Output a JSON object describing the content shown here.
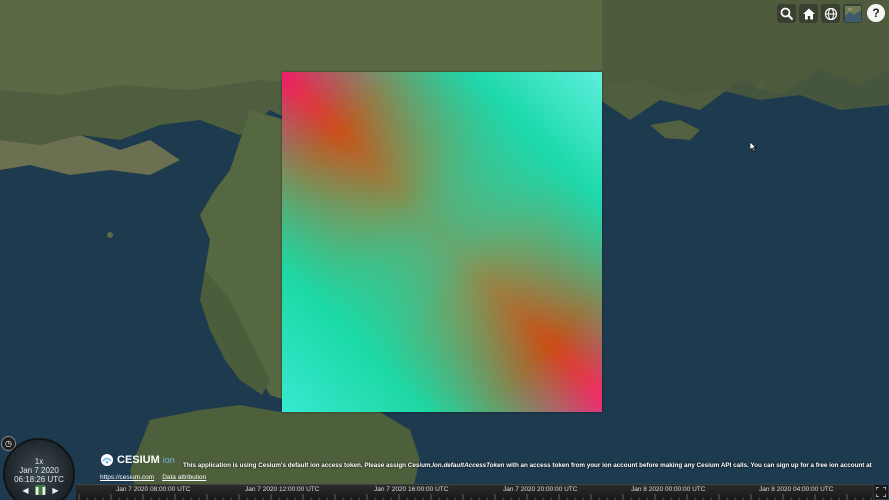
{
  "toolbar": {
    "search_icon": "search-icon",
    "home_icon": "home-icon",
    "scene_mode_icon": "globe-icon",
    "base_layer_icon": "layer-picker-icon",
    "help_label": "?"
  },
  "animation": {
    "speed": "1x",
    "date": "Jan 7 2020",
    "time": "06:18:26 UTC",
    "rewind_label": "◀",
    "pause_label": "❚❚",
    "play_label": "▶"
  },
  "credits": {
    "logo_text": "CESIUM",
    "logo_suffix": "ion",
    "link_site": "https://cesium.com",
    "link_attribution": "Data attribution",
    "token_message_pre": "This application is using Cesium's default ion access token. Please assign ",
    "token_message_code": "Cesium.Ion.defaultAccessToken",
    "token_message_post": " with an access token from your ion account before making any Cesium API calls. You can sign up for a free ion account at"
  },
  "timeline": {
    "labels": [
      "Jan 7 2020 08:00:00 UTC",
      "Jan 7 2020 12:00:00 UTC",
      "Jan 7 2020 16:00:00 UTC",
      "Jan 7 2020 20:00:00 UTC",
      "Jan 8 2020 00:00:00 UTC",
      "Jan 8 2020 04:00:00 UTC"
    ]
  },
  "colors": {
    "overlay_pink": "#ee1f6a",
    "overlay_orange": "#c8531b",
    "overlay_cyan": "#1ee7c0",
    "play_active": "#3b7a3f"
  }
}
